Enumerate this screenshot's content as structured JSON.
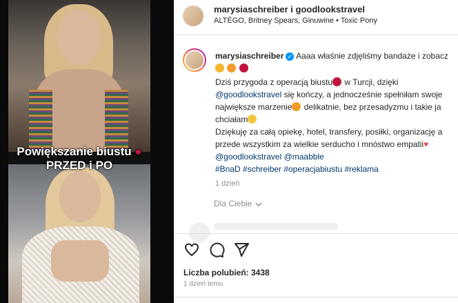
{
  "media": {
    "caption_line1": "Powiększanie biustu",
    "caption_line2": "PRZED i PO"
  },
  "header": {
    "title": "marysiaschreiber i goodlookstravel",
    "audio": "ALTÉGO, Britney Spears, Ginuwine • Toxic Pony"
  },
  "post": {
    "username": "marysiaschreiber",
    "line1": "Aaaa właśnie zdjęliśmy bandaże i zobacz",
    "line3a": "Dziś przygoda z operacją biustu",
    "line3b": " w Turcji, dzięki",
    "line4_mention": "@goodlookstravel",
    "line4_text": " się kończy, a jednocześnie spełniłam swoje",
    "line5": "największe marzenie",
    "line5b": " delikatnie, bez przesadyzmu i takie ja",
    "line6": "chciałam",
    "line7": "Dziękuję za całą opiekę, hotel, transfery, posiłki, organizację a",
    "line8": "przede wszystkim za wielkie serducho i mnóstwo empatii",
    "mention_a": "@goodlookstravel",
    "mention_b": "@maabble",
    "hashtags": "#BnaD #schreiber #operacjabiustu #reklama",
    "time": "1 dzień",
    "for_you": "Dla Ciebie"
  },
  "footer": {
    "likes": "Liczba polubień: 3438",
    "time": "1 dzień temu"
  },
  "icons": {
    "like": "heart-icon",
    "comment": "comment-icon",
    "share": "share-icon",
    "verified": "verified-badge-icon"
  },
  "colors": {
    "link": "#00376b",
    "verified": "#0095f6",
    "muted": "#8e8e8e"
  }
}
